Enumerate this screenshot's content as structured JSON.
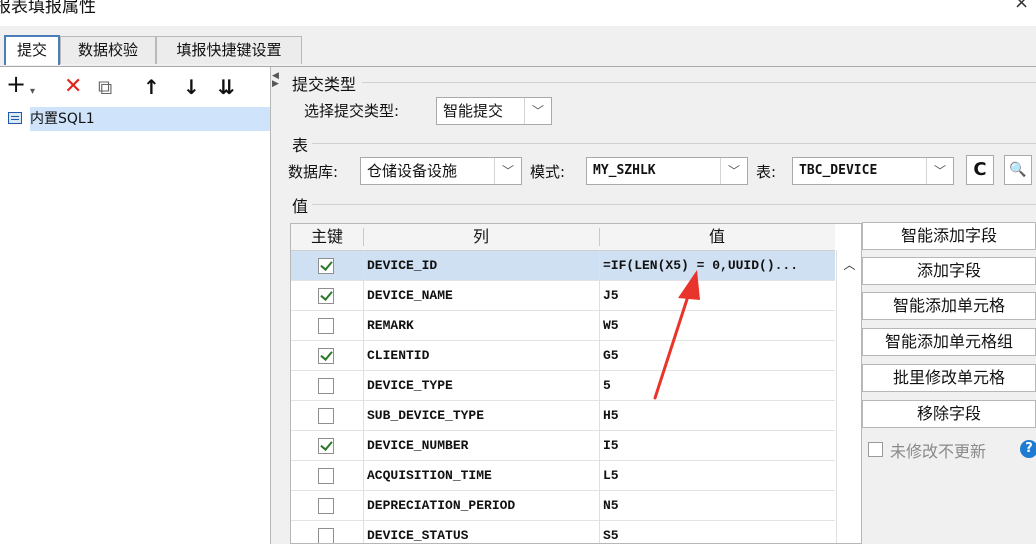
{
  "window": {
    "title": "报表填报属性",
    "close": "×"
  },
  "tabs": [
    "提交",
    "数据校验",
    "填报快捷键设置"
  ],
  "left": {
    "tools": [
      "+",
      "▾",
      "✕",
      "⧉",
      "↑",
      "↓",
      "⇊"
    ],
    "tree_item": "内置SQL1"
  },
  "submit_type": {
    "section": "提交类型",
    "label": "选择提交类型:",
    "value": "智能提交"
  },
  "table_section": {
    "section": "表",
    "db_label": "数据库:",
    "db_value": "仓储设备设施",
    "mode_label": "模式:",
    "mode_value": "MY_SZHLK",
    "table_label": "表:",
    "table_value": "TBC_DEVICE",
    "refresh": "C",
    "preview": "🔍"
  },
  "value_section": {
    "section": "值",
    "headers": {
      "key": "主键",
      "col": "列",
      "val": "值"
    },
    "rows": [
      {
        "key": true,
        "col": "DEVICE_ID",
        "val": "=IF(LEN(X5) = 0,UUID()..."
      },
      {
        "key": true,
        "col": "DEVICE_NAME",
        "val": "J5"
      },
      {
        "key": false,
        "col": "REMARK",
        "val": "W5"
      },
      {
        "key": true,
        "col": "CLIENTID",
        "val": "G5"
      },
      {
        "key": false,
        "col": "DEVICE_TYPE",
        "val": "5"
      },
      {
        "key": false,
        "col": "SUB_DEVICE_TYPE",
        "val": "H5"
      },
      {
        "key": true,
        "col": "DEVICE_NUMBER",
        "val": "I5"
      },
      {
        "key": false,
        "col": "ACQUISITION_TIME",
        "val": "L5"
      },
      {
        "key": false,
        "col": "DEPRECIATION_PERIOD",
        "val": "N5"
      },
      {
        "key": false,
        "col": "DEVICE_STATUS",
        "val": "S5"
      }
    ]
  },
  "actions": {
    "smart_add_field": "智能添加字段",
    "add_field": "添加字段",
    "smart_add_cell": "智能添加单元格",
    "smart_add_cell_group": "智能添加单元格组",
    "batch_modify_cell": "批里修改单元格",
    "remove_field": "移除字段",
    "no_update_label": "未修改不更新",
    "help": "?"
  },
  "colors": {
    "accent": "#4a7ebb",
    "selection": "#cfe0f2",
    "annotation": "#e8342b"
  }
}
